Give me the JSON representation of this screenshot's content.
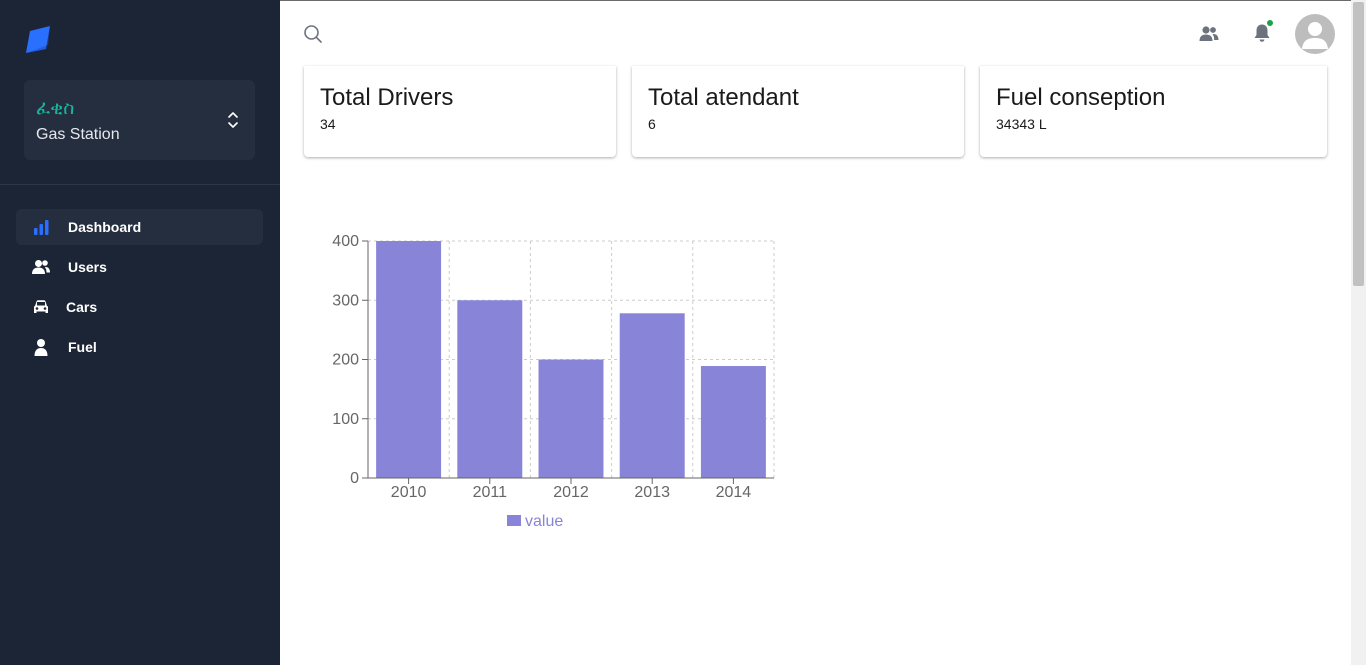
{
  "sidebar": {
    "org": {
      "name": "ፈቂስ",
      "subtitle": "Gas Station"
    },
    "nav": [
      {
        "label": "Dashboard",
        "icon": "bar-chart-icon",
        "active": true
      },
      {
        "label": "Users",
        "icon": "users-icon"
      },
      {
        "label": "Cars",
        "icon": "car-icon"
      },
      {
        "label": "Fuel",
        "icon": "user-icon"
      }
    ]
  },
  "cards": [
    {
      "title": "Total Drivers",
      "value": "34"
    },
    {
      "title": "Total atendant",
      "value": "6"
    },
    {
      "title": "Fuel conseption",
      "value": "34343 L"
    }
  ],
  "colors": {
    "sidebar_bg": "#1c2536",
    "accent": "#15b79e",
    "bar": "#8884d8",
    "notify_dot": "#19a34a"
  },
  "chart_data": {
    "type": "bar",
    "categories": [
      "2010",
      "2011",
      "2012",
      "2013",
      "2014"
    ],
    "series": [
      {
        "name": "value",
        "values": [
          400,
          300,
          200,
          278,
          189
        ]
      }
    ],
    "y_ticks": [
      "0",
      "100",
      "200",
      "300",
      "400"
    ],
    "ylim": [
      0,
      400
    ],
    "grid": true,
    "legend": "bottom"
  }
}
